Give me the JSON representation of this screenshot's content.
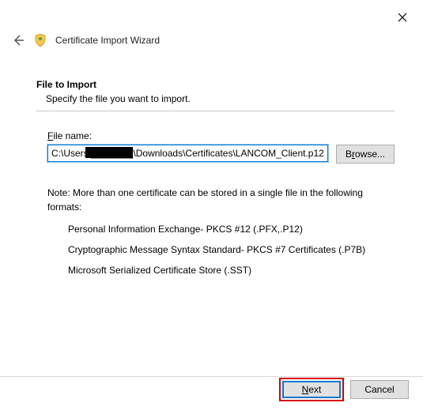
{
  "window": {
    "title": "Certificate Import Wizard"
  },
  "section": {
    "heading": "File to Import",
    "subtext": "Specify the file you want to import."
  },
  "file": {
    "label_pre": "F",
    "label_post": "ile name:",
    "value": "C:\\Users\\________\\Downloads\\Certificates\\LANCOM_Client.p12",
    "browse_pre": "B",
    "browse_post": "r",
    "browse_tail": "owse..."
  },
  "note": {
    "lead": "Note:  More than one certificate can be stored in a single file in the following formats:",
    "items": [
      "Personal Information Exchange- PKCS #12 (.PFX,.P12)",
      "Cryptographic Message Syntax Standard- PKCS #7 Certificates (.P7B)",
      "Microsoft Serialized Certificate Store (.SST)"
    ]
  },
  "buttons": {
    "next_ul": "N",
    "next_tail": "ext",
    "cancel": "Cancel"
  }
}
